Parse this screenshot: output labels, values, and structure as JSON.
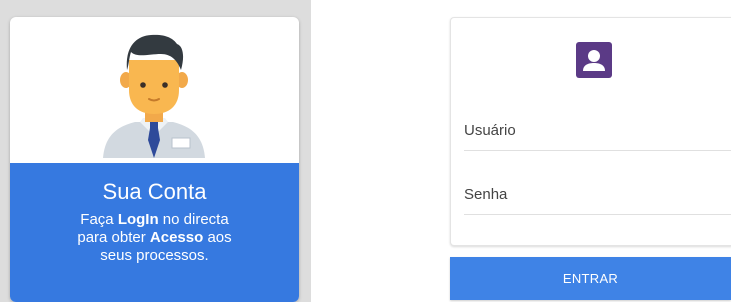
{
  "account_card": {
    "title": "Sua Conta",
    "line1_pre": "Faça ",
    "line1_bold": "LogIn",
    "line1_post": " no directa",
    "line2_pre": "para obter ",
    "line2_bold": "Acesso",
    "line2_post": " aos",
    "line3": "seus processos.",
    "avatar_icon": "user-avatar-illustration",
    "panel_color": "#3679e0"
  },
  "login_form": {
    "badge_icon": "account-box-icon",
    "badge_color": "#5b3a86",
    "username_label": "Usuário",
    "password_label": "Senha",
    "submit_label": "ENTRAR",
    "button_color": "#3f83e6"
  }
}
